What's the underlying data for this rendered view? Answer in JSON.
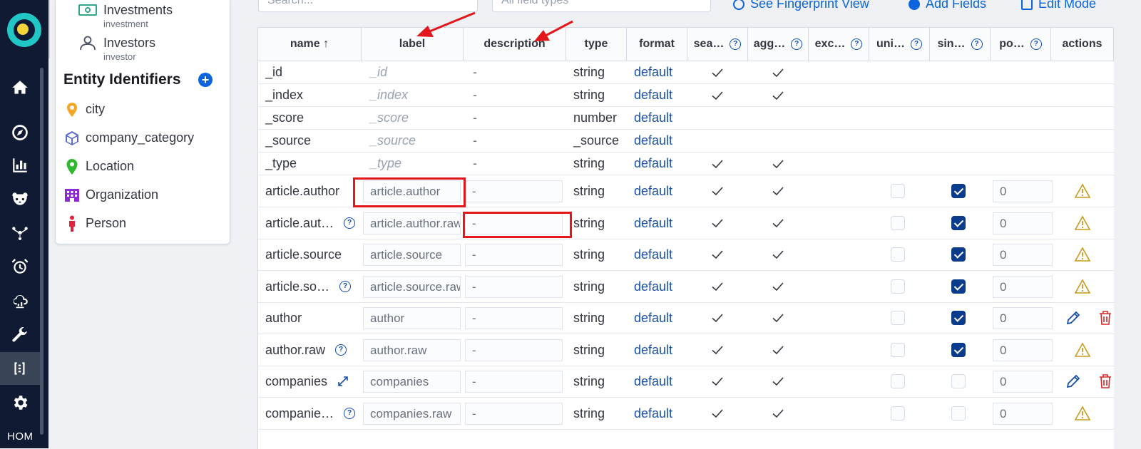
{
  "rail": {
    "bottom_text": "HOM"
  },
  "panel": {
    "relations": [
      {
        "title": "Investments",
        "subtitle": "investment",
        "icon": "money-icon"
      },
      {
        "title": "Investors",
        "subtitle": "investor",
        "icon": "user-icon"
      }
    ],
    "heading": "Entity Identifiers",
    "add_label": "+",
    "entities": [
      {
        "label": "city",
        "icon": "map-pin-icon",
        "color": "#f5a623"
      },
      {
        "label": "company_category",
        "icon": "cube-icon",
        "color": "#5a6acf"
      },
      {
        "label": "Location",
        "icon": "location-icon",
        "color": "#2db82d"
      },
      {
        "label": "Organization",
        "icon": "building-icon",
        "color": "#8e2bd6"
      },
      {
        "label": "Person",
        "icon": "person-icon",
        "color": "#e0213b"
      }
    ]
  },
  "topbar": {
    "search_placeholder": "Search...",
    "types_placeholder": "All field types",
    "fingerprint_label": "See Fingerprint View",
    "add_fields_label": "Add Fields",
    "edit_mode_label": "Edit Mode"
  },
  "table": {
    "headers": [
      {
        "key": "name",
        "label": "name ↑"
      },
      {
        "key": "label",
        "label": "label"
      },
      {
        "key": "description",
        "label": "description"
      },
      {
        "key": "type",
        "label": "type"
      },
      {
        "key": "format",
        "label": "format"
      },
      {
        "key": "searchable",
        "label": "sea…",
        "help": "?"
      },
      {
        "key": "aggregatable",
        "label": "agg…",
        "help": "?"
      },
      {
        "key": "excluded",
        "label": "exc…",
        "help": "?"
      },
      {
        "key": "unique",
        "label": "uni…",
        "help": "?"
      },
      {
        "key": "single",
        "label": "sin…",
        "help": "?"
      },
      {
        "key": "position",
        "label": "po…",
        "help": "?"
      },
      {
        "key": "actions",
        "label": "actions"
      }
    ],
    "meta_rows": [
      {
        "name": "_id",
        "label": "_id",
        "description": "-",
        "type": "string",
        "format": "default",
        "searchable": true,
        "aggregatable": true
      },
      {
        "name": "_index",
        "label": "_index",
        "description": "-",
        "type": "string",
        "format": "default",
        "searchable": true,
        "aggregatable": true
      },
      {
        "name": "_score",
        "label": "_score",
        "description": "-",
        "type": "number",
        "format": "default",
        "searchable": false,
        "aggregatable": false
      },
      {
        "name": "_source",
        "label": "_source",
        "description": "-",
        "type": "_source",
        "format": "default",
        "searchable": false,
        "aggregatable": false
      },
      {
        "name": "_type",
        "label": "_type",
        "description": "-",
        "type": "string",
        "format": "default",
        "searchable": true,
        "aggregatable": true
      }
    ],
    "field_rows": [
      {
        "name": "article.author",
        "help": false,
        "expand": false,
        "label": "article.author",
        "description": "-",
        "type": "string",
        "format": "default",
        "unique": false,
        "single": true,
        "position": "0",
        "action": "warning"
      },
      {
        "name": "article.aut…",
        "help": true,
        "expand": false,
        "label": "article.author.raw",
        "description": "-",
        "type": "string",
        "format": "default",
        "unique": false,
        "single": true,
        "position": "0",
        "action": "warning"
      },
      {
        "name": "article.source",
        "help": false,
        "expand": false,
        "label": "article.source",
        "description": "-",
        "type": "string",
        "format": "default",
        "unique": false,
        "single": true,
        "position": "0",
        "action": "warning"
      },
      {
        "name": "article.so…",
        "help": true,
        "expand": false,
        "label": "article.source.raw",
        "description": "-",
        "type": "string",
        "format": "default",
        "unique": false,
        "single": true,
        "position": "0",
        "action": "warning"
      },
      {
        "name": "author",
        "help": false,
        "expand": false,
        "label": "author",
        "description": "-",
        "type": "string",
        "format": "default",
        "unique": false,
        "single": true,
        "position": "0",
        "action": "edit-delete"
      },
      {
        "name": "author.raw",
        "help": true,
        "expand": false,
        "label": "author.raw",
        "description": "-",
        "type": "string",
        "format": "default",
        "unique": false,
        "single": true,
        "position": "0",
        "action": "warning"
      },
      {
        "name": "companies",
        "help": false,
        "expand": true,
        "label": "companies",
        "description": "-",
        "type": "string",
        "format": "default",
        "unique": false,
        "single": false,
        "position": "0",
        "action": "edit-delete"
      },
      {
        "name": "companie…",
        "help": true,
        "expand": false,
        "label": "companies.raw",
        "description": "-",
        "type": "string",
        "format": "default",
        "unique": false,
        "single": false,
        "position": "0",
        "action": "warning"
      }
    ]
  },
  "colors": {
    "annotation": "#e3161b",
    "link": "#1750a8",
    "checkbox_on": "#0b3c8c",
    "warning": "#c89b1e",
    "delete": "#d62a2a"
  }
}
